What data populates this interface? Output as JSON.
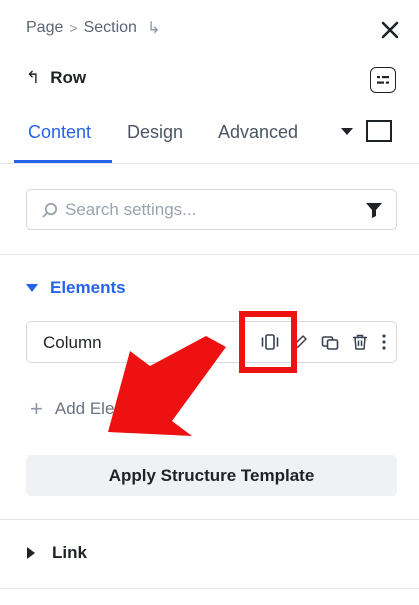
{
  "breadcrumb": {
    "items": [
      "Page",
      "Section"
    ],
    "separator": ">",
    "sub_arrow_icon": "subdirectory-arrow-icon"
  },
  "header": {
    "title": "Row",
    "back_icon": "return-arrow-icon",
    "settings_icon": "row-settings-icon",
    "close_icon": "close-icon"
  },
  "tabs": [
    {
      "label": "Content",
      "active": true
    },
    {
      "label": "Design",
      "active": false
    },
    {
      "label": "Advanced",
      "active": false
    }
  ],
  "search": {
    "placeholder": "Search settings...",
    "value": "",
    "icon": "search-icon",
    "filter_icon": "filter-icon"
  },
  "elements": {
    "label": "Elements",
    "expanded": true,
    "items": [
      {
        "label": "Column",
        "actions": [
          "resize-icon",
          "edit-pencil-icon",
          "duplicate-icon",
          "delete-icon",
          "more-vertical-icon"
        ]
      }
    ],
    "add_label": "Add Element"
  },
  "apply_template": {
    "label": "Apply Structure Template"
  },
  "link_section": {
    "label": "Link",
    "expanded": false
  },
  "colors": {
    "accent": "#2563eb",
    "annotation_red": "#ee1111",
    "text": "#1f2328",
    "muted": "#6b7280"
  }
}
